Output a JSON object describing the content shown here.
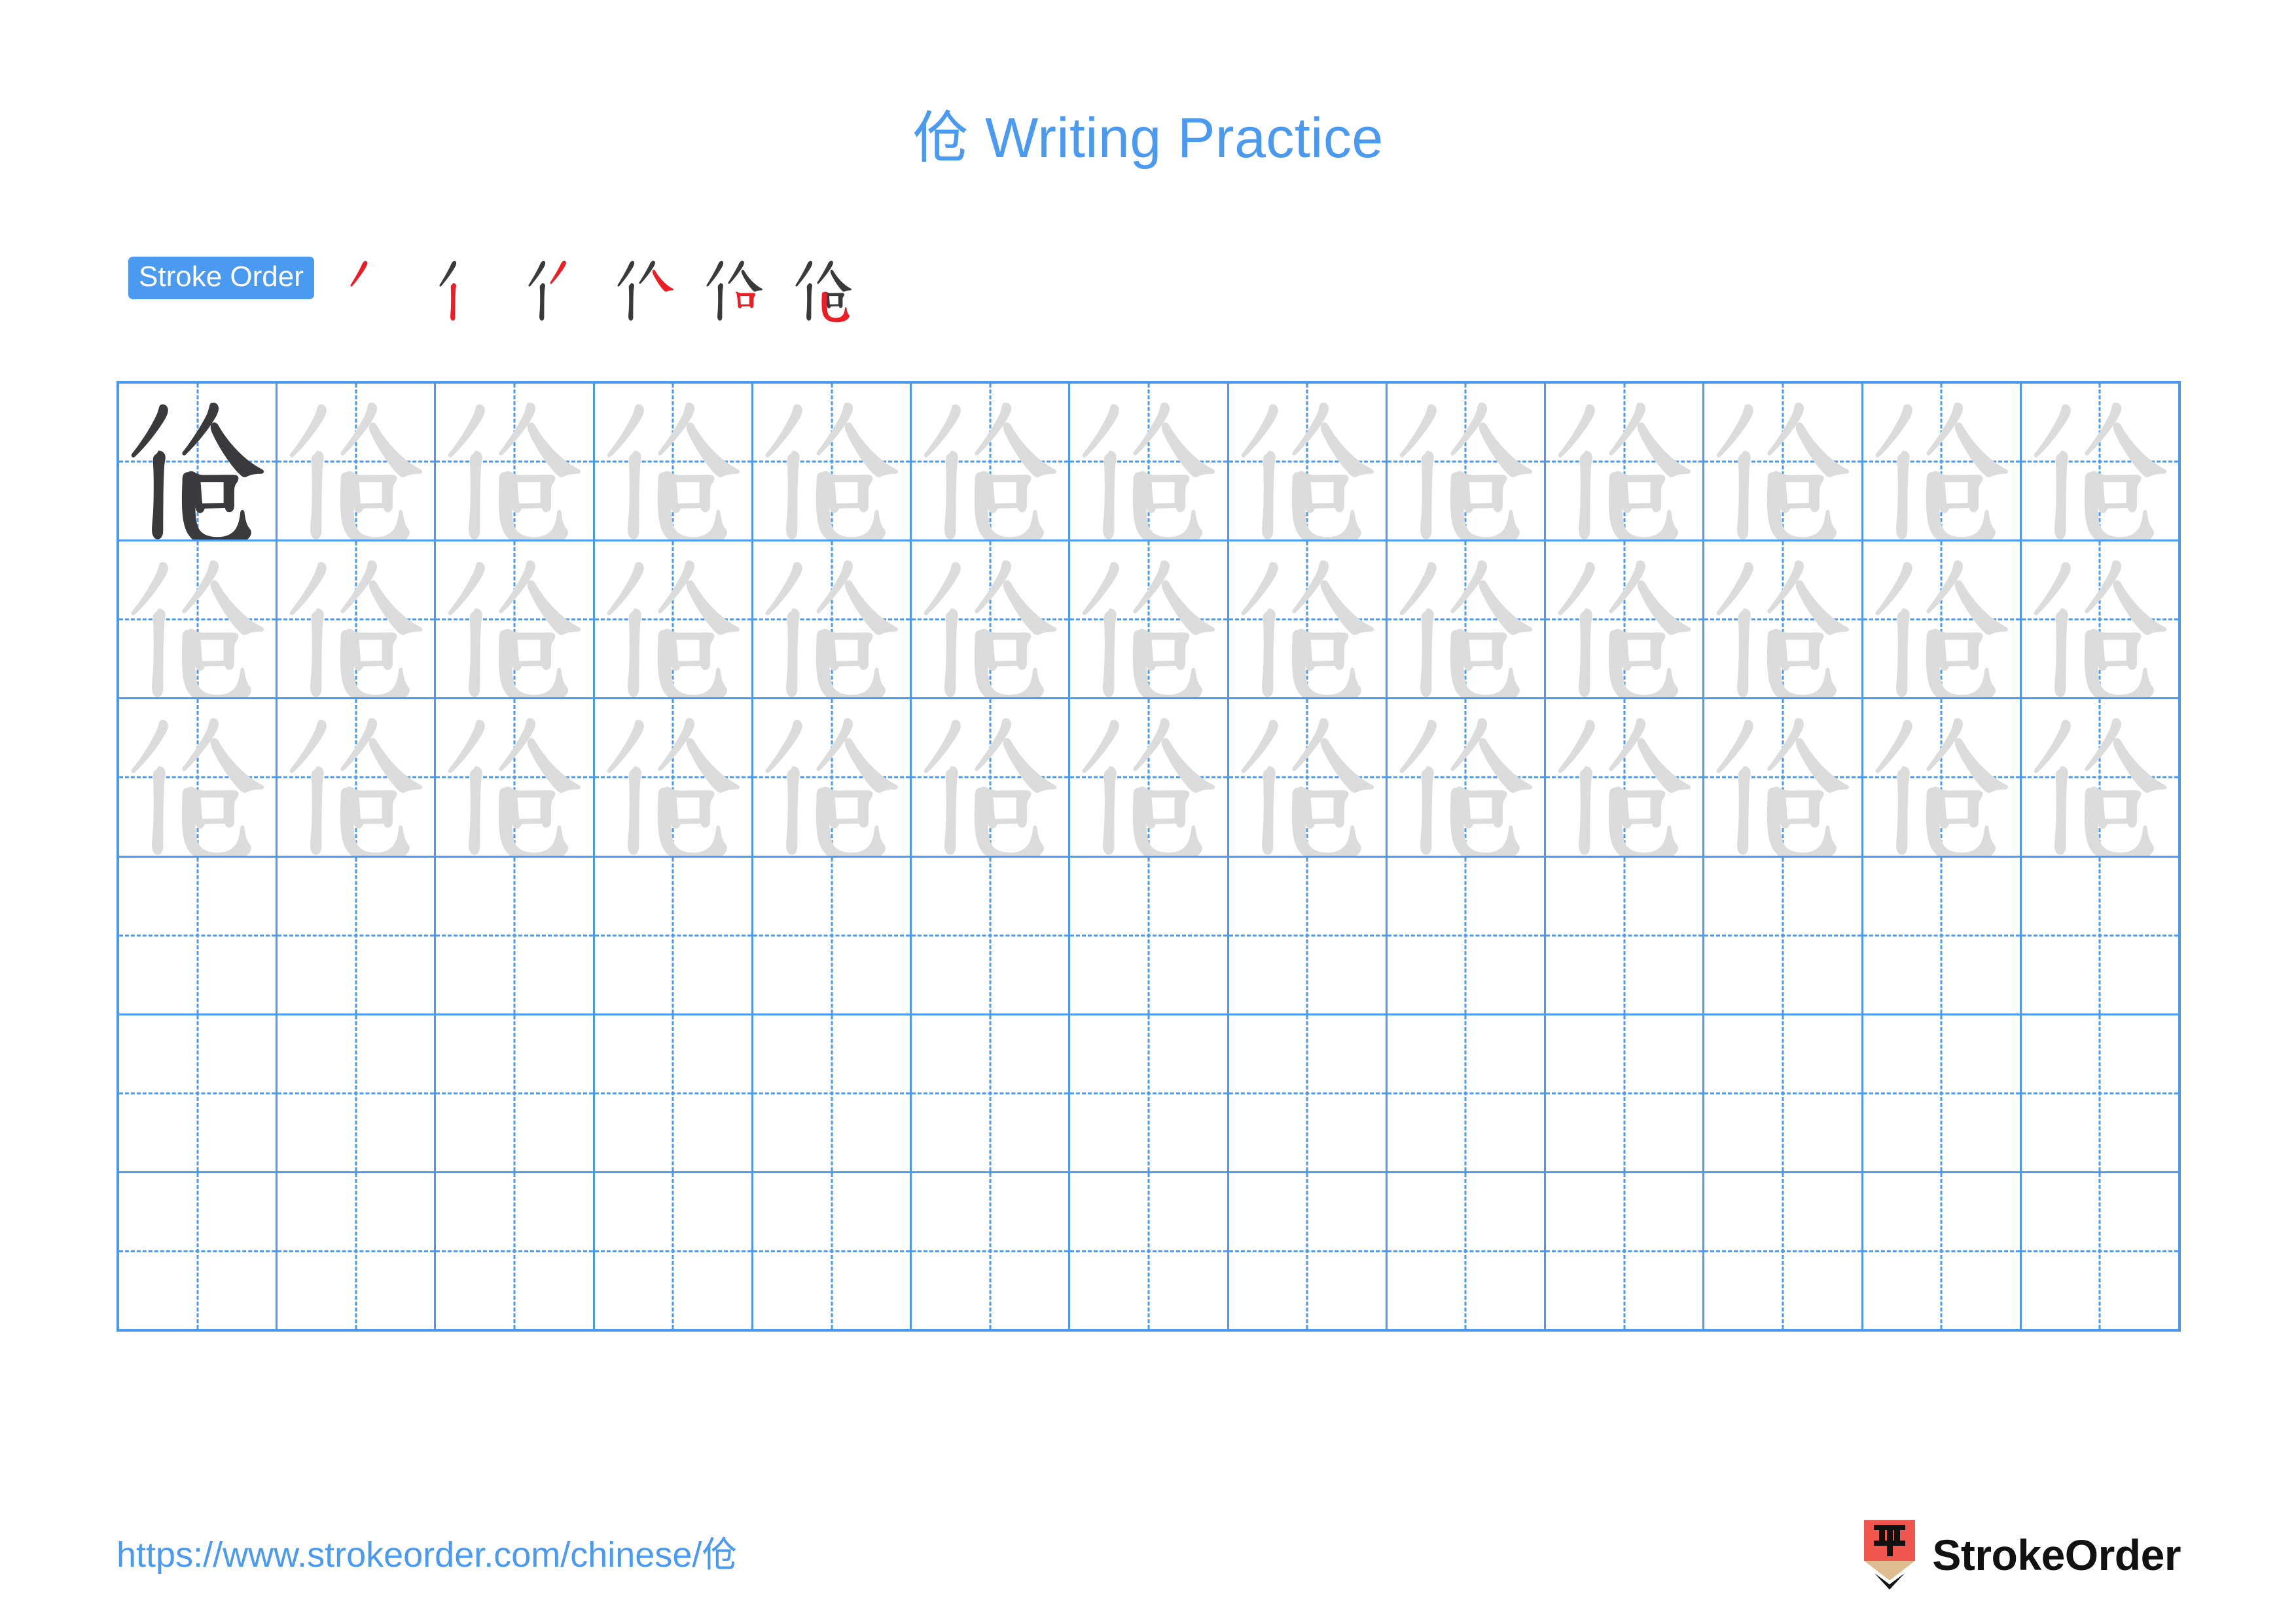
{
  "document": {
    "character": "伧",
    "title": "伧 Writing Practice",
    "type": "chinese-character-writing-practice-worksheet"
  },
  "stroke_order": {
    "badge_label": "Stroke Order",
    "total_strokes": 6,
    "new_stroke_color": "#ee1c25",
    "existing_stroke_color": "#3a3a3c",
    "steps": [
      {
        "index": 1,
        "strokes_shown": 1,
        "new_stroke": "撇 (piě)"
      },
      {
        "index": 2,
        "strokes_shown": 2,
        "new_stroke": "竖 (shù)"
      },
      {
        "index": 3,
        "strokes_shown": 3,
        "new_stroke": "撇 (piě)"
      },
      {
        "index": 4,
        "strokes_shown": 4,
        "new_stroke": "捺 (nà)"
      },
      {
        "index": 5,
        "strokes_shown": 5,
        "new_stroke": "横折 (héngzhé)"
      },
      {
        "index": 6,
        "strokes_shown": 6,
        "new_stroke": "竖弯钩 (shùwāngōu)"
      }
    ]
  },
  "practice_grid": {
    "columns": 13,
    "rows": 6,
    "grid_line_color": "#4a9af2",
    "guide_line_style": "dashed",
    "dark_model_character_cells": [
      {
        "row": 1,
        "col": 1
      }
    ],
    "faint_trace_rows": [
      1,
      2,
      3
    ],
    "empty_rows": [
      4,
      5,
      6
    ],
    "faint_character_color": "#dcdcdc",
    "dark_character_color": "#3a3a3c"
  },
  "footer": {
    "url": "https://www.strokeorder.com/chinese/伧",
    "brand_name": "StrokeOrder",
    "logo_character": "字",
    "logo_body_color": "#f0564e",
    "logo_wood_color": "#e0bc91",
    "logo_tip_color": "#111111"
  },
  "theme": {
    "accent_blue": "#4a9af2",
    "background": "#ffffff",
    "badge_text": "#ffffff"
  }
}
